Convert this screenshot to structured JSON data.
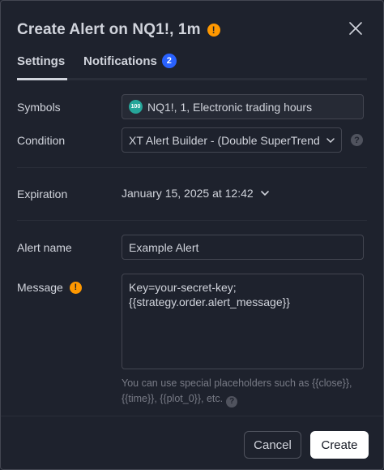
{
  "dialog": {
    "title": "Create Alert on NQ1!, 1m",
    "warn_glyph": "!",
    "close_icon": "close-icon"
  },
  "tabs": [
    {
      "label": "Settings",
      "active": true
    },
    {
      "label": "Notifications",
      "badge": "2"
    }
  ],
  "form": {
    "symbols": {
      "label": "Symbols",
      "icon_text": "100",
      "value": "NQ1!, 1, Electronic trading hours"
    },
    "condition": {
      "label": "Condition",
      "value": "XT Alert Builder - (Double SuperTrend"
    },
    "expiration": {
      "label": "Expiration",
      "value": "January 15, 2025 at 12:42"
    },
    "alert_name": {
      "label": "Alert name",
      "value": "Example Alert"
    },
    "message": {
      "label": "Message",
      "value": "Key=your-secret-key;\n{{strategy.order.alert_message}}",
      "hint": "You can use special placeholders such as {{close}}, {{time}}, {{plot_0}}, etc."
    }
  },
  "footer": {
    "cancel_label": "Cancel",
    "create_label": "Create"
  },
  "colors": {
    "background": "#1e222d",
    "warning": "#ff9800",
    "badge": "#2962ff",
    "symbol_icon": "#26a69a"
  }
}
